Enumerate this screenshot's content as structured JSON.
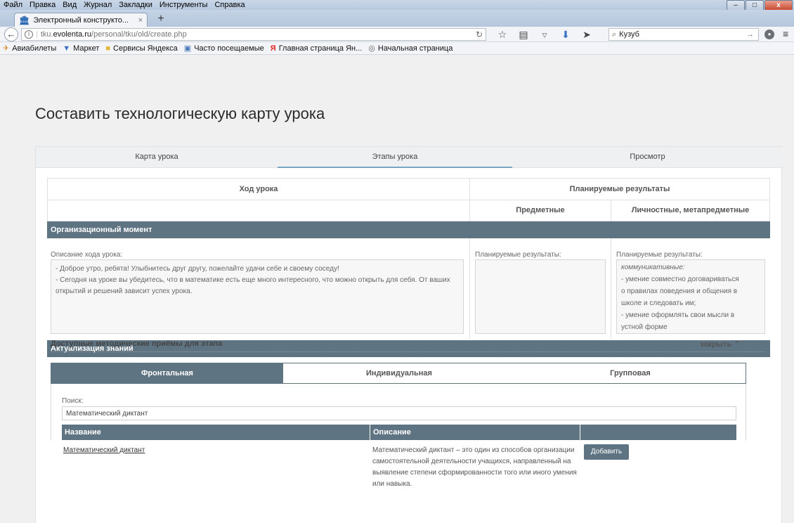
{
  "menubar": {
    "items": [
      "Файл",
      "Правка",
      "Вид",
      "Журнал",
      "Закладки",
      "Инструменты",
      "Справка"
    ],
    "window_controls": [
      "–",
      "□",
      "x"
    ]
  },
  "browser": {
    "tab_title": "Электронный конструкто...",
    "tab_close": "×",
    "new_tab": "+",
    "url_prefix": "tku.",
    "url_domain": "evolenta.ru",
    "url_path": "/personal/tku/old/create.php",
    "search_value": "Кузуб",
    "search_go": "→"
  },
  "bookmarks": [
    {
      "label": "Авиабилеты",
      "icon": "plane-icon"
    },
    {
      "label": "Маркет",
      "icon": "cart-icon"
    },
    {
      "label": "Сервисы Яндекса",
      "icon": "folder-icon"
    },
    {
      "label": "Часто посещаемые",
      "icon": "history-icon"
    },
    {
      "label": "Главная страница Ян...",
      "icon": "yandex-icon"
    },
    {
      "label": "Начальная страница",
      "icon": "globe-icon"
    }
  ],
  "page": {
    "title": "Составить технологическую карту урока",
    "tabs": [
      "Карта урока",
      "Этапы урока",
      "Просмотр"
    ],
    "active_tab": "Этапы урока",
    "grid": {
      "progress_header": "Ход урока",
      "results_header": "Планируемые результаты",
      "subject_header": "Предметные",
      "personal_header": "Личностные, метапредметные"
    },
    "stages": [
      {
        "name": "Организационный момент",
        "description_label": "Описание хода урока:",
        "description": [
          "- Доброе утро, ребята! Улыбнитесь друг другу, пожелайте удачи себе и своему соседу!",
          "- Сегодня на уроке вы убедитесь, что в математике есть еще много интересного, что можно открыть для себя. От ваших",
          "открытий и решений зависит успех урока."
        ],
        "subject_label": "Планируемые результаты:",
        "personal_label": "Планируемые результаты:",
        "personal_heading": "коммуникативные:",
        "personal_lines": [
          "- умение совместно договариваться",
          "о правилах поведения и общения в",
          "школе и следовать им;",
          "- умение оформлять свои мысли в",
          "устной форме"
        ]
      },
      {
        "name": "Актуализация знаний"
      }
    ],
    "methods": {
      "title": "Доступные методические приёмы для этапа",
      "close": "закрыть",
      "tabs": [
        "Фронтальная",
        "Индивидуальная",
        "Групповая"
      ],
      "active_tab": "Фронтальная",
      "search_label": "Поиск:",
      "search_value": "Математический диктант",
      "columns": [
        "Название",
        "Описание",
        ""
      ],
      "rows": [
        {
          "name": "Математический диктант",
          "description": [
            "Математический диктант – это один из способов организации",
            "самостоятельной деятельности учащихся, направленный на",
            "выявление степени сформированности того или иного умения",
            "или навыка."
          ],
          "action": "Добавить"
        }
      ]
    }
  }
}
